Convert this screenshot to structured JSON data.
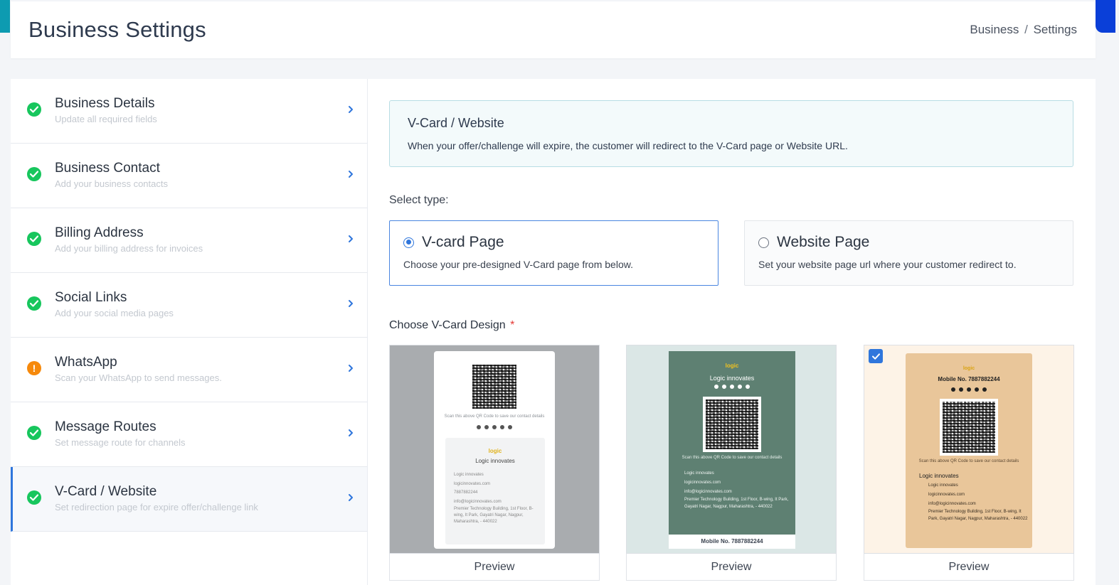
{
  "header": {
    "title": "Business Settings",
    "breadcrumb": {
      "parent": "Business",
      "separator": "/",
      "current": "Settings"
    }
  },
  "sidebar": {
    "items": [
      {
        "title": "Business Details",
        "subtitle": "Update all required fields",
        "status": "complete"
      },
      {
        "title": "Business Contact",
        "subtitle": "Add your business contacts",
        "status": "complete"
      },
      {
        "title": "Billing Address",
        "subtitle": "Add your billing address for invoices",
        "status": "complete"
      },
      {
        "title": "Social Links",
        "subtitle": "Add your social media pages",
        "status": "complete"
      },
      {
        "title": "WhatsApp",
        "subtitle": "Scan your WhatsApp to send messages.",
        "status": "warning",
        "warning_glyph": "!"
      },
      {
        "title": "Message Routes",
        "subtitle": "Set message route for channels",
        "status": "complete"
      },
      {
        "title": "V-Card / Website",
        "subtitle": "Set redirection page for expire offer/challenge link",
        "status": "complete",
        "active": true
      }
    ]
  },
  "main": {
    "info": {
      "title": "V-Card / Website",
      "text": "When your offer/challenge will expire, the customer will redirect to the V-Card page or Website URL."
    },
    "select_type_label": "Select type:",
    "types": [
      {
        "title": "V-card Page",
        "description": "Choose your pre-designed V-Card page from below.",
        "selected": true
      },
      {
        "title": "Website Page",
        "description": "Set your website page url where your customer redirect to.",
        "selected": false
      }
    ],
    "design_label": "Choose V-Card Design",
    "required_mark": "*",
    "designs": [
      {
        "preview_label": "Preview",
        "selected": false,
        "theme": {
          "bg": "#a9acaf",
          "card": "#ffffff"
        },
        "scan_text": "Scan this above QR Code to save our contact details",
        "logo_text": "logic",
        "company": "Logic innovates",
        "details": [
          "Logic innovates",
          "logicinnovates.com",
          "7887882244",
          "info@logicinnovates.com",
          "Premier Technology Building, 1st Floor, B-wing, It Park, Gayatri Nagar, Nagpur, Maharashtra, - 440022"
        ]
      },
      {
        "preview_label": "Preview",
        "selected": false,
        "theme": {
          "bg": "#dbe7e6",
          "card": "#5e8072"
        },
        "logo_text": "logic",
        "company": "Logic innovates",
        "scan_text": "Scan this above QR Code to save our contact details",
        "details": [
          "Logic innovates",
          "logicinnovates.com",
          "info@logicinnovates.com",
          "Premier Technology Building, 1st Floor, B-wing, It Park, Gayatri Nagar, Nagpur, Maharashtra, - 440022"
        ],
        "mobile": "Mobile No. 7887882244"
      },
      {
        "preview_label": "Preview",
        "selected": true,
        "theme": {
          "bg": "#fdf3e7",
          "card": "#e9c69a"
        },
        "logo_text": "logic",
        "mobile": "Mobile No. 7887882244",
        "scan_text": "Scan this above QR Code to save our contact details",
        "company": "Logic innovates",
        "details": [
          "Logic innovates",
          "logicinnovates.com",
          "info@logicinnovates.com",
          "Premier Technology Building, 1st Floor, B-wing, It Park, Gayatri Nagar, Nagpur, Maharashtra, - 440022"
        ]
      }
    ]
  },
  "colors": {
    "accent": "#2f76dc",
    "success": "#17c65d",
    "warning": "#f6890b",
    "info_bg": "#f3fafb",
    "info_border": "#b8dde4"
  },
  "icons": {
    "complete": "check-circle-icon",
    "warning": "exclamation-circle-icon",
    "chevron": "chevron-right-icon",
    "checkbox": "check-icon"
  }
}
